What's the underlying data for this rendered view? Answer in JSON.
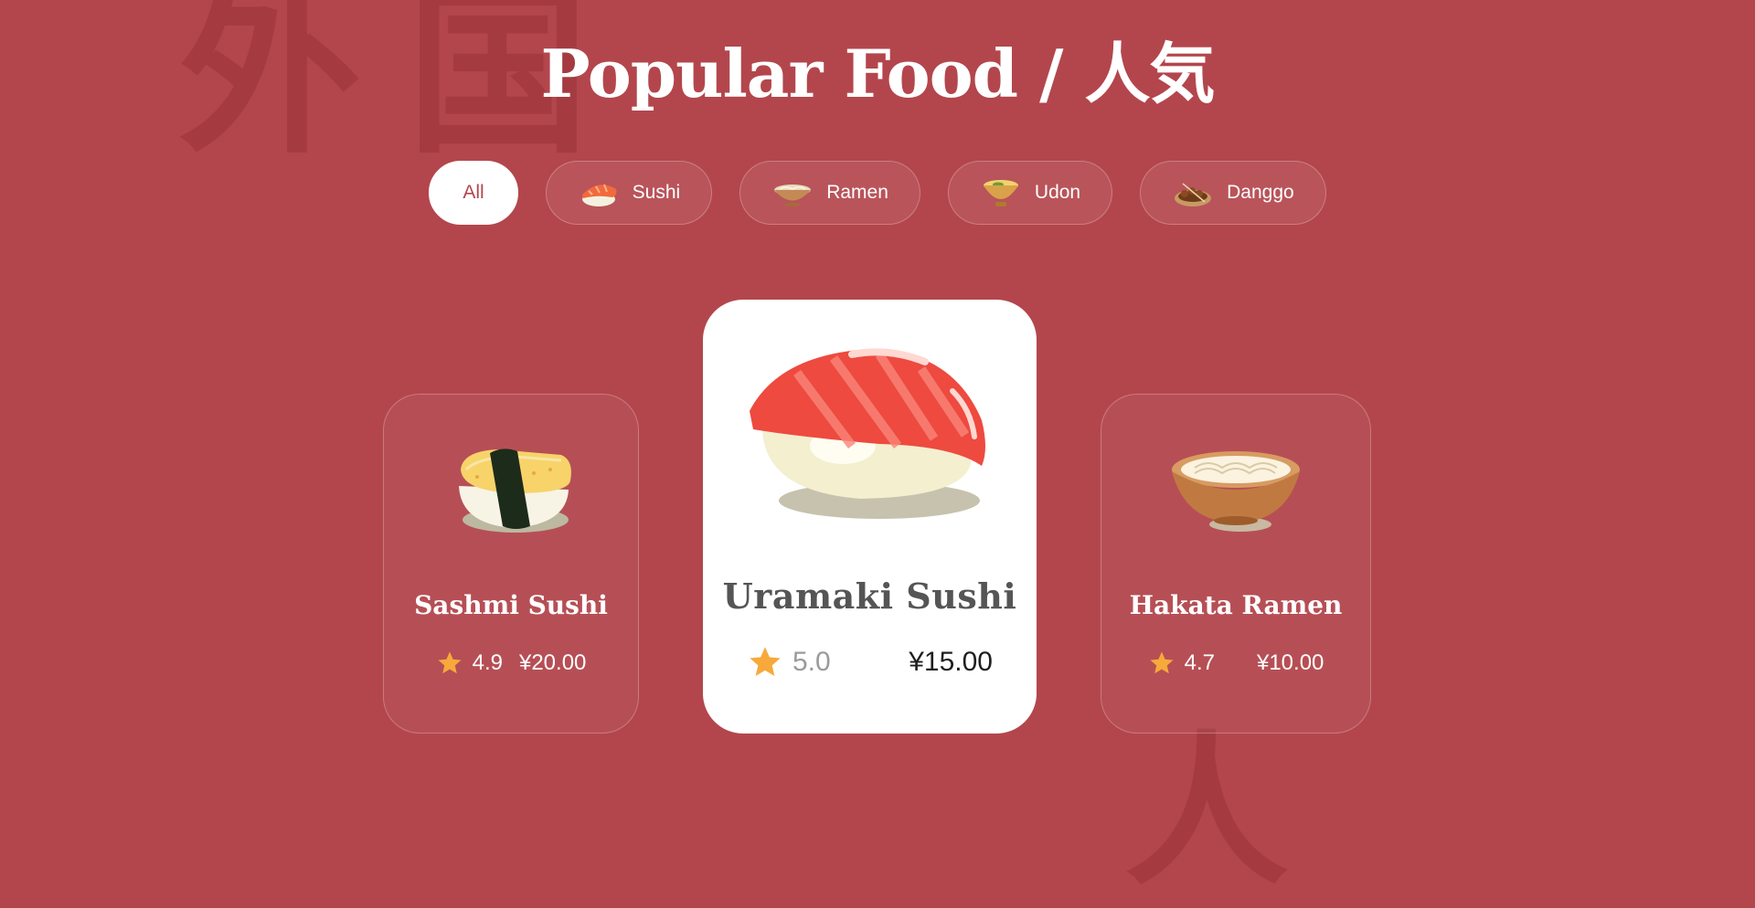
{
  "header": {
    "title_text": "Popular Food / ",
    "title_kanji": "人気"
  },
  "filters": [
    {
      "label": "All",
      "active": true,
      "icon": ""
    },
    {
      "label": "Sushi",
      "active": false,
      "icon": "sushi-icon"
    },
    {
      "label": "Ramen",
      "active": false,
      "icon": "ramen-bowl-icon"
    },
    {
      "label": "Udon",
      "active": false,
      "icon": "udon-bowl-icon"
    },
    {
      "label": "Danggo",
      "active": false,
      "icon": "dango-icon"
    }
  ],
  "cards": [
    {
      "name": "Sashmi Sushi",
      "rating": "4.9",
      "price": "¥20.00",
      "image": "tamago-sushi-image",
      "featured": false
    },
    {
      "name": "Uramaki Sushi",
      "rating": "5.0",
      "price": "¥15.00",
      "image": "salmon-nigiri-image",
      "featured": true
    },
    {
      "name": "Hakata Ramen",
      "rating": "4.7",
      "price": "¥10.00",
      "image": "ramen-bowl-image",
      "featured": false
    }
  ],
  "background_glyphs": [
    "外",
    "国",
    "人"
  ],
  "colors": {
    "background": "#b3464c",
    "accent_star": "#f7a93b",
    "card_featured": "#ffffff"
  }
}
